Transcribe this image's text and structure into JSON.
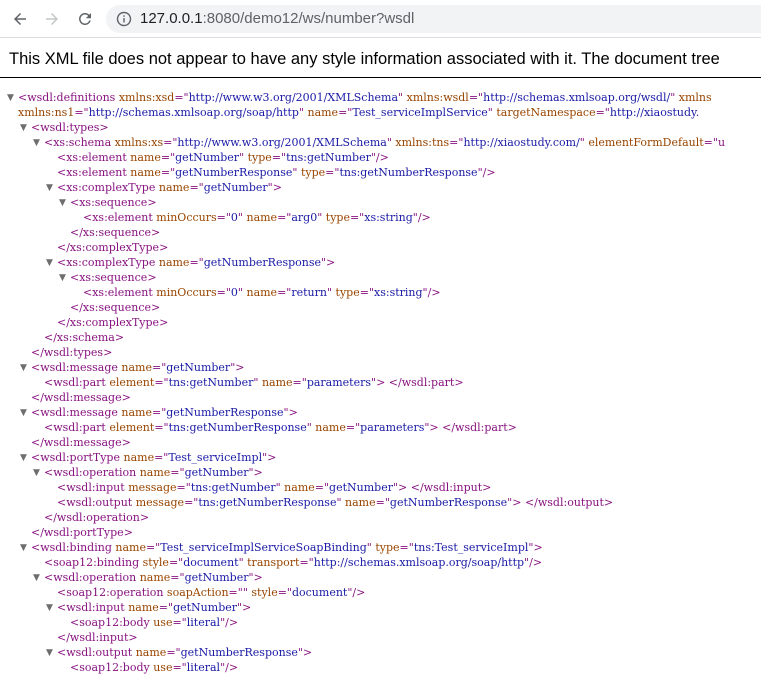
{
  "browser": {
    "url_host": "127.0.0.1",
    "url_path": ":8080/demo12/ws/number?wsdl"
  },
  "xml_notice": "This XML file does not appear to have any style information associated with it. The document tree",
  "colors": {
    "tag": "#881280",
    "attr_name": "#994500",
    "attr_value": "#1a1aa6"
  },
  "lines": [
    {
      "i": 0,
      "t": 1,
      "p": [
        [
          "g",
          "<wsdl:definitions "
        ],
        [
          "n",
          "xmlns:xsd"
        ],
        [
          "g",
          "=\""
        ],
        [
          "v",
          "http://www.w3.org/2001/XMLSchema"
        ],
        [
          "g",
          "\" "
        ],
        [
          "n",
          "xmlns:wsdl"
        ],
        [
          "g",
          "=\""
        ],
        [
          "v",
          "http://schemas.xmlsoap.org/wsdl/"
        ],
        [
          "g",
          "\" "
        ],
        [
          "n",
          "xmlns"
        ]
      ]
    },
    {
      "i": 0,
      "t": 0,
      "p": [
        [
          "n",
          "xmlns:ns1"
        ],
        [
          "g",
          "=\""
        ],
        [
          "v",
          "http://schemas.xmlsoap.org/soap/http"
        ],
        [
          "g",
          "\" "
        ],
        [
          "n",
          "name"
        ],
        [
          "g",
          "=\""
        ],
        [
          "v",
          "Test_serviceImplService"
        ],
        [
          "g",
          "\" "
        ],
        [
          "n",
          "targetNamespace"
        ],
        [
          "g",
          "=\""
        ],
        [
          "v",
          "http://xiaostudy."
        ]
      ]
    },
    {
      "i": 1,
      "t": 1,
      "p": [
        [
          "g",
          "<wsdl:types>"
        ]
      ]
    },
    {
      "i": 2,
      "t": 1,
      "p": [
        [
          "g",
          "<xs:schema "
        ],
        [
          "n",
          "xmlns:xs"
        ],
        [
          "g",
          "=\""
        ],
        [
          "v",
          "http://www.w3.org/2001/XMLSchema"
        ],
        [
          "g",
          "\" "
        ],
        [
          "n",
          "xmlns:tns"
        ],
        [
          "g",
          "=\""
        ],
        [
          "v",
          "http://xiaostudy.com/"
        ],
        [
          "g",
          "\" "
        ],
        [
          "n",
          "elementFormDefault"
        ],
        [
          "g",
          "=\"u"
        ]
      ]
    },
    {
      "i": 3,
      "t": 0,
      "p": [
        [
          "g",
          "<xs:element "
        ],
        [
          "n",
          "name"
        ],
        [
          "g",
          "=\""
        ],
        [
          "v",
          "getNumber"
        ],
        [
          "g",
          "\" "
        ],
        [
          "n",
          "type"
        ],
        [
          "g",
          "=\""
        ],
        [
          "v",
          "tns:getNumber"
        ],
        [
          "g",
          "\"/>"
        ]
      ]
    },
    {
      "i": 3,
      "t": 0,
      "p": [
        [
          "g",
          "<xs:element "
        ],
        [
          "n",
          "name"
        ],
        [
          "g",
          "=\""
        ],
        [
          "v",
          "getNumberResponse"
        ],
        [
          "g",
          "\" "
        ],
        [
          "n",
          "type"
        ],
        [
          "g",
          "=\""
        ],
        [
          "v",
          "tns:getNumberResponse"
        ],
        [
          "g",
          "\"/>"
        ]
      ]
    },
    {
      "i": 3,
      "t": 1,
      "p": [
        [
          "g",
          "<xs:complexType "
        ],
        [
          "n",
          "name"
        ],
        [
          "g",
          "=\""
        ],
        [
          "v",
          "getNumber"
        ],
        [
          "g",
          "\">"
        ]
      ]
    },
    {
      "i": 4,
      "t": 1,
      "p": [
        [
          "g",
          "<xs:sequence>"
        ]
      ]
    },
    {
      "i": 5,
      "t": 0,
      "p": [
        [
          "g",
          "<xs:element "
        ],
        [
          "n",
          "minOccurs"
        ],
        [
          "g",
          "=\""
        ],
        [
          "v",
          "0"
        ],
        [
          "g",
          "\" "
        ],
        [
          "n",
          "name"
        ],
        [
          "g",
          "=\""
        ],
        [
          "v",
          "arg0"
        ],
        [
          "g",
          "\" "
        ],
        [
          "n",
          "type"
        ],
        [
          "g",
          "=\""
        ],
        [
          "v",
          "xs:string"
        ],
        [
          "g",
          "\"/>"
        ]
      ]
    },
    {
      "i": 4,
      "t": 0,
      "p": [
        [
          "g",
          "</xs:sequence>"
        ]
      ]
    },
    {
      "i": 3,
      "t": 0,
      "p": [
        [
          "g",
          "</xs:complexType>"
        ]
      ]
    },
    {
      "i": 3,
      "t": 1,
      "p": [
        [
          "g",
          "<xs:complexType "
        ],
        [
          "n",
          "name"
        ],
        [
          "g",
          "=\""
        ],
        [
          "v",
          "getNumberResponse"
        ],
        [
          "g",
          "\">"
        ]
      ]
    },
    {
      "i": 4,
      "t": 1,
      "p": [
        [
          "g",
          "<xs:sequence>"
        ]
      ]
    },
    {
      "i": 5,
      "t": 0,
      "p": [
        [
          "g",
          "<xs:element "
        ],
        [
          "n",
          "minOccurs"
        ],
        [
          "g",
          "=\""
        ],
        [
          "v",
          "0"
        ],
        [
          "g",
          "\" "
        ],
        [
          "n",
          "name"
        ],
        [
          "g",
          "=\""
        ],
        [
          "v",
          "return"
        ],
        [
          "g",
          "\" "
        ],
        [
          "n",
          "type"
        ],
        [
          "g",
          "=\""
        ],
        [
          "v",
          "xs:string"
        ],
        [
          "g",
          "\"/>"
        ]
      ]
    },
    {
      "i": 4,
      "t": 0,
      "p": [
        [
          "g",
          "</xs:sequence>"
        ]
      ]
    },
    {
      "i": 3,
      "t": 0,
      "p": [
        [
          "g",
          "</xs:complexType>"
        ]
      ]
    },
    {
      "i": 2,
      "t": 0,
      "p": [
        [
          "g",
          "</xs:schema>"
        ]
      ]
    },
    {
      "i": 1,
      "t": 0,
      "p": [
        [
          "g",
          "</wsdl:types>"
        ]
      ]
    },
    {
      "i": 1,
      "t": 1,
      "p": [
        [
          "g",
          "<wsdl:message "
        ],
        [
          "n",
          "name"
        ],
        [
          "g",
          "=\""
        ],
        [
          "v",
          "getNumber"
        ],
        [
          "g",
          "\">"
        ]
      ]
    },
    {
      "i": 2,
      "t": 0,
      "p": [
        [
          "g",
          "<wsdl:part "
        ],
        [
          "n",
          "element"
        ],
        [
          "g",
          "=\""
        ],
        [
          "v",
          "tns:getNumber"
        ],
        [
          "g",
          "\" "
        ],
        [
          "n",
          "name"
        ],
        [
          "g",
          "=\""
        ],
        [
          "v",
          "parameters"
        ],
        [
          "g",
          "\"> </wsdl:part>"
        ]
      ]
    },
    {
      "i": 1,
      "t": 0,
      "p": [
        [
          "g",
          "</wsdl:message>"
        ]
      ]
    },
    {
      "i": 1,
      "t": 1,
      "p": [
        [
          "g",
          "<wsdl:message "
        ],
        [
          "n",
          "name"
        ],
        [
          "g",
          "=\""
        ],
        [
          "v",
          "getNumberResponse"
        ],
        [
          "g",
          "\">"
        ]
      ]
    },
    {
      "i": 2,
      "t": 0,
      "p": [
        [
          "g",
          "<wsdl:part "
        ],
        [
          "n",
          "element"
        ],
        [
          "g",
          "=\""
        ],
        [
          "v",
          "tns:getNumberResponse"
        ],
        [
          "g",
          "\" "
        ],
        [
          "n",
          "name"
        ],
        [
          "g",
          "=\""
        ],
        [
          "v",
          "parameters"
        ],
        [
          "g",
          "\"> </wsdl:part>"
        ]
      ]
    },
    {
      "i": 1,
      "t": 0,
      "p": [
        [
          "g",
          "</wsdl:message>"
        ]
      ]
    },
    {
      "i": 1,
      "t": 1,
      "p": [
        [
          "g",
          "<wsdl:portType "
        ],
        [
          "n",
          "name"
        ],
        [
          "g",
          "=\""
        ],
        [
          "v",
          "Test_serviceImpl"
        ],
        [
          "g",
          "\">"
        ]
      ]
    },
    {
      "i": 2,
      "t": 1,
      "p": [
        [
          "g",
          "<wsdl:operation "
        ],
        [
          "n",
          "name"
        ],
        [
          "g",
          "=\""
        ],
        [
          "v",
          "getNumber"
        ],
        [
          "g",
          "\">"
        ]
      ]
    },
    {
      "i": 3,
      "t": 0,
      "p": [
        [
          "g",
          "<wsdl:input "
        ],
        [
          "n",
          "message"
        ],
        [
          "g",
          "=\""
        ],
        [
          "v",
          "tns:getNumber"
        ],
        [
          "g",
          "\" "
        ],
        [
          "n",
          "name"
        ],
        [
          "g",
          "=\""
        ],
        [
          "v",
          "getNumber"
        ],
        [
          "g",
          "\"> </wsdl:input>"
        ]
      ]
    },
    {
      "i": 3,
      "t": 0,
      "p": [
        [
          "g",
          "<wsdl:output "
        ],
        [
          "n",
          "message"
        ],
        [
          "g",
          "=\""
        ],
        [
          "v",
          "tns:getNumberResponse"
        ],
        [
          "g",
          "\" "
        ],
        [
          "n",
          "name"
        ],
        [
          "g",
          "=\""
        ],
        [
          "v",
          "getNumberResponse"
        ],
        [
          "g",
          "\"> </wsdl:output>"
        ]
      ]
    },
    {
      "i": 2,
      "t": 0,
      "p": [
        [
          "g",
          "</wsdl:operation>"
        ]
      ]
    },
    {
      "i": 1,
      "t": 0,
      "p": [
        [
          "g",
          "</wsdl:portType>"
        ]
      ]
    },
    {
      "i": 1,
      "t": 1,
      "p": [
        [
          "g",
          "<wsdl:binding "
        ],
        [
          "n",
          "name"
        ],
        [
          "g",
          "=\""
        ],
        [
          "v",
          "Test_serviceImplServiceSoapBinding"
        ],
        [
          "g",
          "\" "
        ],
        [
          "n",
          "type"
        ],
        [
          "g",
          "=\""
        ],
        [
          "v",
          "tns:Test_serviceImpl"
        ],
        [
          "g",
          "\">"
        ]
      ]
    },
    {
      "i": 2,
      "t": 0,
      "p": [
        [
          "g",
          "<soap12:binding "
        ],
        [
          "n",
          "style"
        ],
        [
          "g",
          "=\""
        ],
        [
          "v",
          "document"
        ],
        [
          "g",
          "\" "
        ],
        [
          "n",
          "transport"
        ],
        [
          "g",
          "=\""
        ],
        [
          "v",
          "http://schemas.xmlsoap.org/soap/http"
        ],
        [
          "g",
          "\"/>"
        ]
      ]
    },
    {
      "i": 2,
      "t": 1,
      "p": [
        [
          "g",
          "<wsdl:operation "
        ],
        [
          "n",
          "name"
        ],
        [
          "g",
          "=\""
        ],
        [
          "v",
          "getNumber"
        ],
        [
          "g",
          "\">"
        ]
      ]
    },
    {
      "i": 3,
      "t": 0,
      "p": [
        [
          "g",
          "<soap12:operation "
        ],
        [
          "n",
          "soapAction"
        ],
        [
          "g",
          "=\"\" "
        ],
        [
          "n",
          "style"
        ],
        [
          "g",
          "=\""
        ],
        [
          "v",
          "document"
        ],
        [
          "g",
          "\"/>"
        ]
      ]
    },
    {
      "i": 3,
      "t": 1,
      "p": [
        [
          "g",
          "<wsdl:input "
        ],
        [
          "n",
          "name"
        ],
        [
          "g",
          "=\""
        ],
        [
          "v",
          "getNumber"
        ],
        [
          "g",
          "\">"
        ]
      ]
    },
    {
      "i": 4,
      "t": 0,
      "p": [
        [
          "g",
          "<soap12:body "
        ],
        [
          "n",
          "use"
        ],
        [
          "g",
          "=\""
        ],
        [
          "v",
          "literal"
        ],
        [
          "g",
          "\"/>"
        ]
      ]
    },
    {
      "i": 3,
      "t": 0,
      "p": [
        [
          "g",
          "</wsdl:input>"
        ]
      ]
    },
    {
      "i": 3,
      "t": 1,
      "p": [
        [
          "g",
          "<wsdl:output "
        ],
        [
          "n",
          "name"
        ],
        [
          "g",
          "=\""
        ],
        [
          "v",
          "getNumberResponse"
        ],
        [
          "g",
          "\">"
        ]
      ]
    },
    {
      "i": 4,
      "t": 0,
      "p": [
        [
          "g",
          "<soap12:body "
        ],
        [
          "n",
          "use"
        ],
        [
          "g",
          "=\""
        ],
        [
          "v",
          "literal"
        ],
        [
          "g",
          "\"/>"
        ]
      ]
    }
  ]
}
